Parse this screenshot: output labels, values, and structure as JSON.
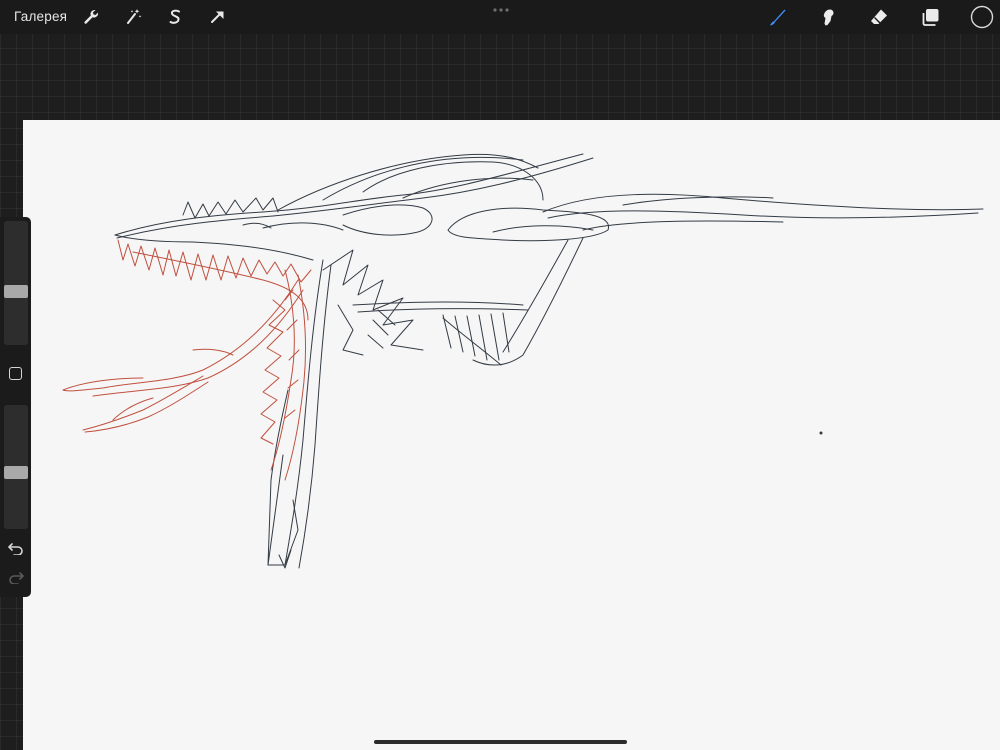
{
  "app": {
    "gallery_label": "Галерея"
  },
  "toolbar": {
    "left_tools": [
      "wrench-icon",
      "magic-wand-icon",
      "selection-s-icon",
      "transform-arrow-icon"
    ],
    "right_tools": [
      "brush-icon",
      "smudge-icon",
      "eraser-icon",
      "layers-icon",
      "color-circle-icon"
    ],
    "active_tool": "brush-icon",
    "active_color": "#3d8ef5",
    "current_color": "#1a1a1a"
  },
  "sidebar": {
    "brush_size_level": 0.42,
    "opacity_level": 0.45,
    "buttons": [
      "modify-square-icon",
      "undo-icon",
      "redo-icon"
    ]
  },
  "canvas": {
    "background": "#f6f6f6",
    "ink_color": "#333b45",
    "accent_ink_color": "#c0503e"
  }
}
